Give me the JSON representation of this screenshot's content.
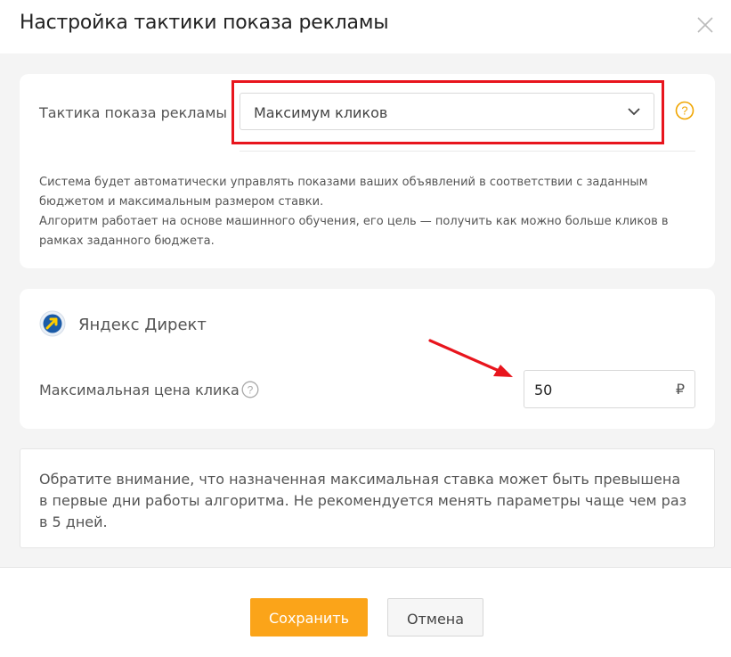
{
  "dialog": {
    "title": "Настройка тактики показа рекламы",
    "close_icon": "close-icon"
  },
  "tactic": {
    "label": "Тактика показа рекламы",
    "selected": "Максимум кликов",
    "help_icon": "question-circle-icon",
    "description": [
      "Система будет автоматически управлять показами ваших объявлений в соответствии с заданным бюджетом и максимальным размером ставки.",
      "Алгоритм работает на основе машинного обучения, его цель — получить как можно больше кликов в рамках заданного бюджета."
    ]
  },
  "yandex": {
    "title": "Яндекс Директ",
    "logo_icon": "yandex-direct-logo",
    "price_label": "Максимальная цена клика",
    "price_value": "50",
    "currency": "₽"
  },
  "note": {
    "text": "Обратите внимание, что назначенная максимальная ставка может быть превышена в первые дни работы алгоритма. Не рекомендуется менять параметры чаще чем раз в 5 дней."
  },
  "footer": {
    "save_label": "Сохранить",
    "cancel_label": "Отмена"
  },
  "colors": {
    "accent": "#fba419",
    "highlight": "#e8151d",
    "help_icon": "#f0a500"
  }
}
